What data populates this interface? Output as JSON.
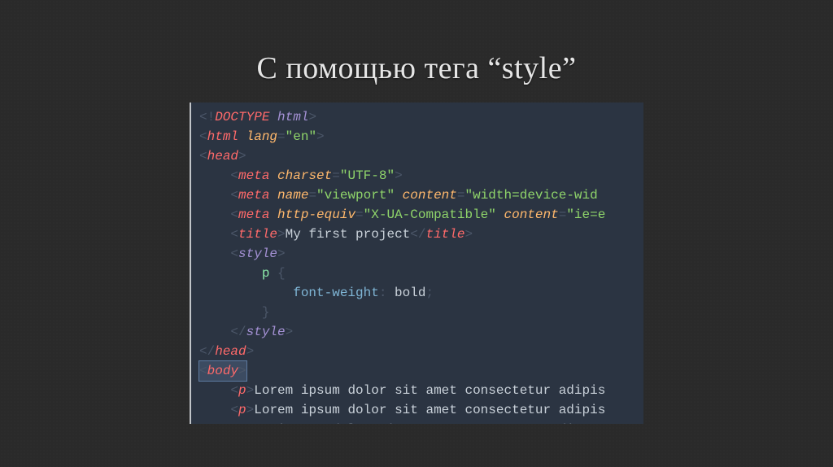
{
  "title": "С помощью тега “style”",
  "code": {
    "l1": {
      "b1": "<!",
      "doctype": "DOCTYPE",
      "sp": " ",
      "html": "html",
      "b2": ">"
    },
    "l2": {
      "b1": "<",
      "tag": "html",
      "sp": " ",
      "a": "lang",
      "eq": "=",
      "v": "\"en\"",
      "b2": ">"
    },
    "l3": {
      "b1": "<",
      "tag": "head",
      "b2": ">"
    },
    "l4": {
      "ind": "    ",
      "b1": "<",
      "tag": "meta",
      "sp": " ",
      "a": "charset",
      "eq": "=",
      "v": "\"UTF-8\"",
      "b2": ">"
    },
    "l5": {
      "ind": "    ",
      "b1": "<",
      "tag": "meta",
      "sp": " ",
      "a1": "name",
      "eq1": "=",
      "v1": "\"viewport\"",
      "sp2": " ",
      "a2": "content",
      "eq2": "=",
      "v2": "\"width=device-wid"
    },
    "l6": {
      "ind": "    ",
      "b1": "<",
      "tag": "meta",
      "sp": " ",
      "a1": "http-equiv",
      "eq1": "=",
      "v1": "\"X-UA-Compatible\"",
      "sp2": " ",
      "a2": "content",
      "eq2": "=",
      "v2": "\"ie=e"
    },
    "l7": {
      "ind": "    ",
      "b1": "<",
      "tag": "title",
      "b2": ">",
      "txt": "My first project",
      "b3": "</",
      "tag2": "title",
      "b4": ">"
    },
    "l8": {
      "ind": "    ",
      "b1": "<",
      "tag": "style",
      "b2": ">"
    },
    "l9": {
      "ind": "        ",
      "sel": "p",
      "sp": " ",
      "brace": "{"
    },
    "l10": {
      "ind": "            ",
      "prop": "font-weight",
      "colon": ": ",
      "val": "bold",
      "semi": ";"
    },
    "l11": {
      "ind": "        ",
      "brace": "}"
    },
    "l12": {
      "ind": "    ",
      "b1": "</",
      "tag": "style",
      "b2": ">"
    },
    "l13": {
      "b1": "</",
      "tag": "head",
      "b2": ">"
    },
    "l14": {
      "b1": "<",
      "tag": "body",
      "b2": ">"
    },
    "l15": {
      "ind": "    ",
      "b1": "<",
      "tag": "p",
      "b2": ">",
      "txt": "Lorem ipsum dolor sit amet consectetur adipis"
    },
    "l16": {
      "ind": "    ",
      "b1": "<",
      "tag": "p",
      "b2": ">",
      "txt": "Lorem ipsum dolor sit amet consectetur adipis"
    },
    "l17": {
      "ind": "    ",
      "txt": "Lorem ipsum  dolor sit amet  consectetur adip"
    }
  }
}
